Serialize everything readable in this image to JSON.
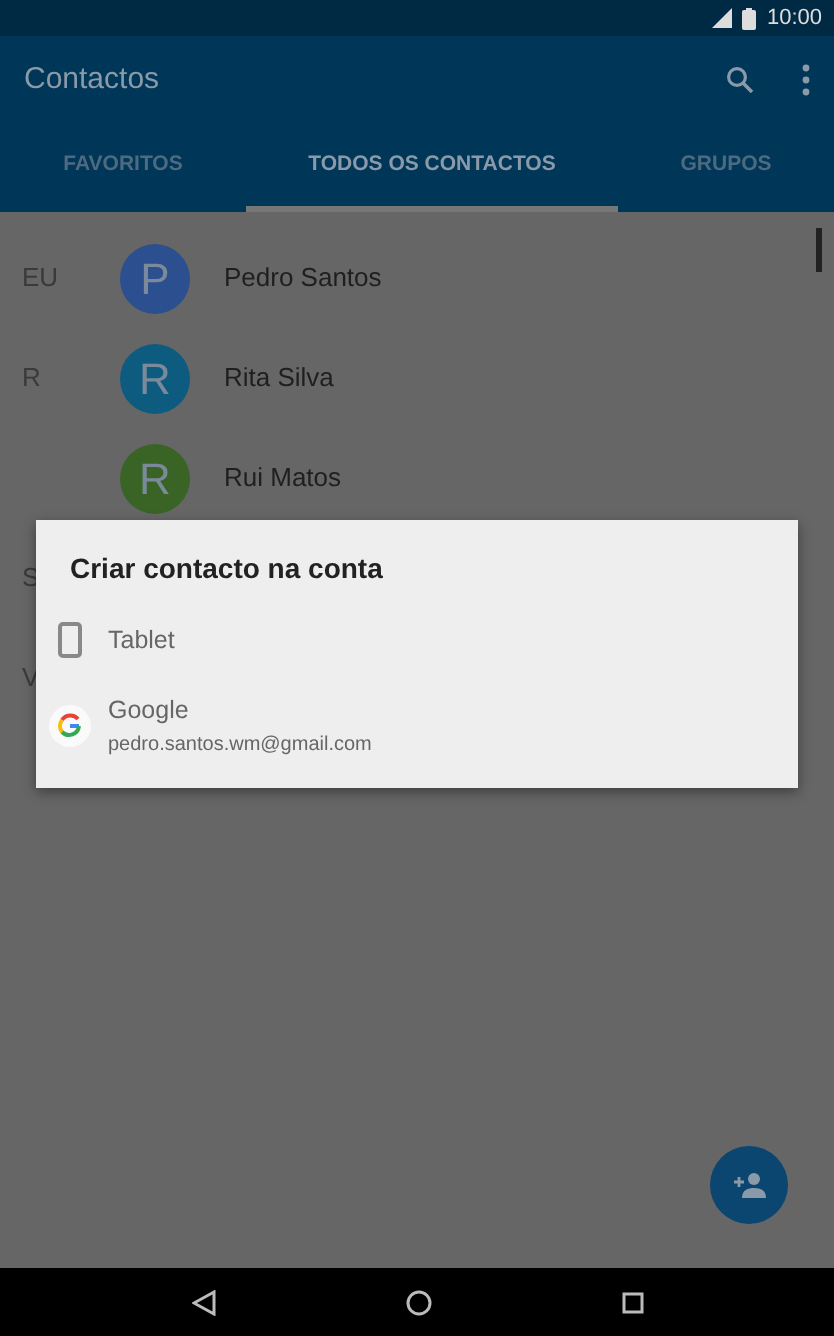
{
  "status_bar": {
    "time": "10:00"
  },
  "app_bar": {
    "title": "Contactos"
  },
  "tabs": [
    {
      "label": "FAVORITOS",
      "selected": false
    },
    {
      "label": "TODOS OS CONTACTOS",
      "selected": true
    },
    {
      "label": "GRUPOS",
      "selected": false
    }
  ],
  "contacts": [
    {
      "section": "EU",
      "initial": "P",
      "name": "Pedro Santos",
      "color": "#2b4f8f"
    },
    {
      "section": "R",
      "initial": "R",
      "name": "Rita Silva",
      "color": "#0d5c80"
    },
    {
      "initial": "R",
      "name": "Rui Matos",
      "color": "#3a6326"
    },
    {
      "section": "S"
    },
    {
      "section": "V"
    }
  ],
  "dialog": {
    "title": "Criar contacto na conta",
    "accounts": [
      {
        "kind": "tablet",
        "label": "Tablet"
      },
      {
        "kind": "google",
        "label": "Google",
        "detail": "pedro.santos.wm@gmail.com"
      }
    ]
  }
}
